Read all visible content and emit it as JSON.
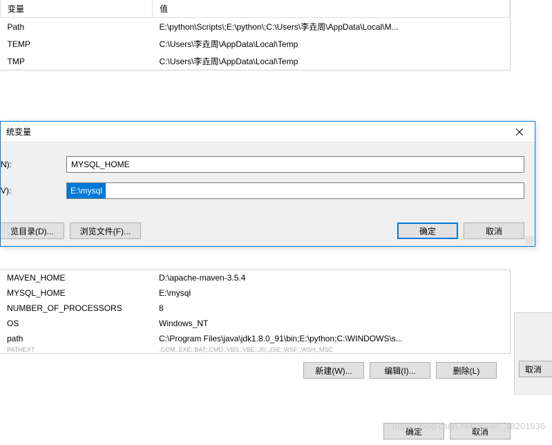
{
  "top_table": {
    "headers": {
      "variable": "变量",
      "value": "值"
    },
    "rows": [
      {
        "variable": "Path",
        "value": "E:\\python\\Scripts\\;E:\\python\\;C:\\Users\\李垚周\\AppData\\Local\\M..."
      },
      {
        "variable": "TEMP",
        "value": "C:\\Users\\李垚周\\AppData\\Local\\Temp"
      },
      {
        "variable": "TMP",
        "value": "C:\\Users\\李垚周\\AppData\\Local\\Temp"
      }
    ]
  },
  "dialog": {
    "title": "统变量",
    "name_label": "N):",
    "value_label": "V):",
    "name_value": "MYSQL_HOME",
    "value_value": "E:\\mysql",
    "browse_dir": "览目录(D)...",
    "browse_file": "浏览文件(F)...",
    "ok": "确定",
    "cancel": "取消"
  },
  "sys_table": {
    "rows": [
      {
        "variable": "MAVEN_HOME",
        "value": "D:\\apache-maven-3.5.4"
      },
      {
        "variable": "MYSQL_HOME",
        "value": "E:\\mysql"
      },
      {
        "variable": "NUMBER_OF_PROCESSORS",
        "value": "8"
      },
      {
        "variable": "OS",
        "value": "Windows_NT"
      },
      {
        "variable": "path",
        "value": "C:\\Program Files\\java\\jdk1.8.0_91\\bin;E:\\python;C:\\WINDOWS\\s..."
      },
      {
        "variable": "PATHEXT",
        "value": ".COM;.EXE;.BAT;.CMD;.VBS;.VBE;.JS;.JSE;.WSF;.WSH;.MSC"
      }
    ]
  },
  "lower_buttons": {
    "new": "新建(W)...",
    "edit": "编辑(I)...",
    "delete": "删除(L)"
  },
  "bottom_buttons": {
    "ok": "确定",
    "cancel": "取消"
  },
  "right_cancel": "取消",
  "watermark": "https://blog.csdn.net/weixin_38201936"
}
